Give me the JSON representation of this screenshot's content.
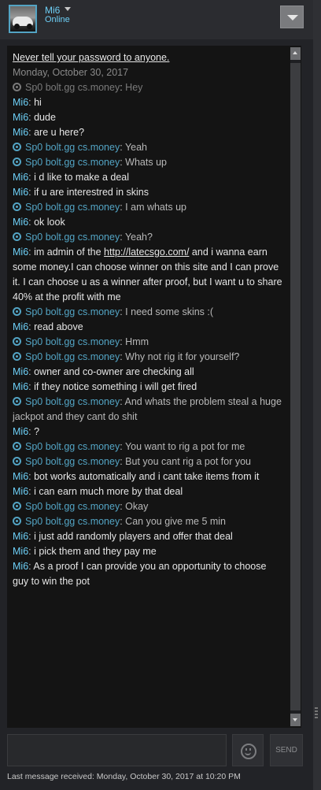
{
  "header": {
    "name": "Mi6",
    "status": "Online"
  },
  "log": {
    "warning": "Never tell your password to anyone.",
    "date": "Monday, October 30, 2017",
    "messages": [
      {
        "from": "Sp0 bolt.gg cs.money",
        "text": "Hey",
        "friend": true,
        "old": true
      },
      {
        "from": "Mi6",
        "text": "hi",
        "friend": false
      },
      {
        "from": "Mi6",
        "text": "dude",
        "friend": false
      },
      {
        "from": "Mi6",
        "text": "are u here?",
        "friend": false
      },
      {
        "from": "Sp0 bolt.gg cs.money",
        "text": "Yeah",
        "friend": true
      },
      {
        "from": "Sp0 bolt.gg cs.money",
        "text": "Whats up",
        "friend": true
      },
      {
        "from": "Mi6",
        "text": "i d like to make a deal",
        "friend": false
      },
      {
        "from": "Mi6",
        "text": "if u are interestred in skins",
        "friend": false
      },
      {
        "from": "Sp0 bolt.gg cs.money",
        "text": "I am whats up",
        "friend": true
      },
      {
        "from": "Mi6",
        "text": "ok look",
        "friend": false
      },
      {
        "from": "Sp0 bolt.gg cs.money",
        "text": "Yeah?",
        "friend": true
      },
      {
        "from": "Mi6",
        "text_before": "im admin of the ",
        "link": "http://latecsgo.com/",
        "text": " and i wanna earn some money.I can choose winner on this site and I can prove it. I can choose u as a winner after proof, but I want u to share 40% at the profit with me",
        "friend": false
      },
      {
        "from": "Sp0 bolt.gg cs.money",
        "text": "I need some skins :(",
        "friend": true
      },
      {
        "from": "Mi6",
        "text": "read above",
        "friend": false
      },
      {
        "from": "Sp0 bolt.gg cs.money",
        "text": "Hmm",
        "friend": true
      },
      {
        "from": "Sp0 bolt.gg cs.money",
        "text": "Why not rig it for yourself?",
        "friend": true
      },
      {
        "from": "Mi6",
        "text": "owner and co-owner are checking all",
        "friend": false
      },
      {
        "from": "Mi6",
        "text": "if they notice something i will get fired",
        "friend": false
      },
      {
        "from": "Sp0 bolt.gg cs.money",
        "text": "And whats the problem steal a huge jackpot and they cant do shit",
        "friend": true
      },
      {
        "from": "Mi6",
        "text": "?",
        "friend": false
      },
      {
        "from": "Sp0 bolt.gg cs.money",
        "text": "You want to rig a pot for me",
        "friend": true
      },
      {
        "from": "Sp0 bolt.gg cs.money",
        "text": "But you cant rig a pot for you",
        "friend": true
      },
      {
        "from": "Mi6",
        "text": "bot works automatically and i cant take items from it",
        "friend": false
      },
      {
        "from": "Mi6",
        "text": "i can earn much more by that deal",
        "friend": false
      },
      {
        "from": "Sp0 bolt.gg cs.money",
        "text": "Okay",
        "friend": true
      },
      {
        "from": "Sp0 bolt.gg cs.money",
        "text": "Can you give me 5 min",
        "friend": true
      },
      {
        "from": "Mi6",
        "text": "i just add randomly players and offer that deal",
        "friend": false
      },
      {
        "from": "Mi6",
        "text": "i pick them and they pay me",
        "friend": false
      },
      {
        "from": "Mi6",
        "text": "As a proof I can provide you an opportunity to choose guy to win the pot",
        "friend": false
      }
    ]
  },
  "input": {
    "placeholder": "",
    "send_label": "SEND"
  },
  "footer": {
    "last_received": "Last message received: Monday, October 30, 2017 at 10:20 PM"
  },
  "colors": {
    "self_name": "#6dcff6",
    "friend_name": "#53a4c4",
    "background": "#222327",
    "log_background": "#141414"
  },
  "icons": {
    "friend_message": "steam-icon",
    "menu": "dropdown-triangle-icon",
    "emoji": "smiley-icon"
  }
}
